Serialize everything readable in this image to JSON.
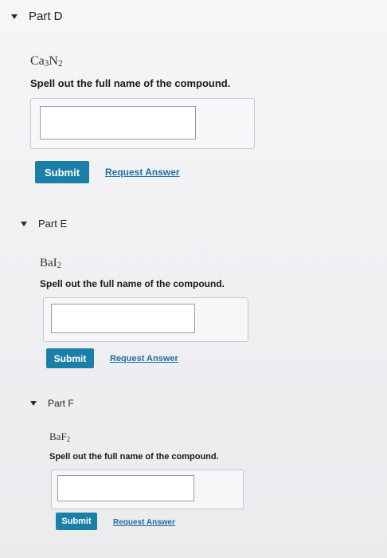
{
  "parts": [
    {
      "title": "Part D",
      "formula": {
        "el1": "Ca",
        "n1": "3",
        "el2": "N",
        "n2": "2"
      },
      "prompt": "Spell out the full name of the compound.",
      "input_value": "",
      "submit_label": "Submit",
      "request_label": "Request Answer"
    },
    {
      "title": "Part E",
      "formula": {
        "el1": "BaI",
        "n1": "2"
      },
      "prompt": "Spell out the full name of the compound.",
      "input_value": "",
      "submit_label": "Submit",
      "request_label": "Request Answer"
    },
    {
      "title": "Part F",
      "formula": {
        "el1": "BaF",
        "n1": "2"
      },
      "prompt": "Spell out the full name of the compound.",
      "input_value": "",
      "submit_label": "Submit",
      "request_label": "Request Answer"
    }
  ],
  "colors": {
    "submit_bg": "#1b7fa8",
    "link": "#1c6fa3"
  }
}
